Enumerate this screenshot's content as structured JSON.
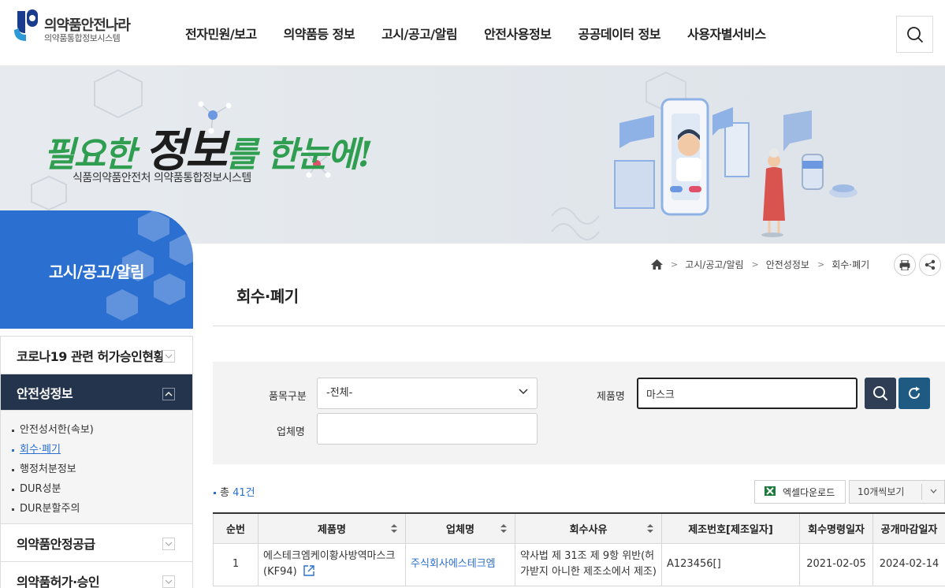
{
  "header": {
    "logo_title": "의약품안전나라",
    "logo_sub": "의약품통합정보시스템",
    "nav": [
      "전자민원/보고",
      "의약품등 정보",
      "고시/공고/알림",
      "안전사용정보",
      "공공데이터 정보",
      "사용자별서비스"
    ],
    "search_icon": "search-icon"
  },
  "banner": {
    "slogan_a": "필요한 ",
    "slogan_hl": "정보",
    "slogan_b": "를 한눈에!",
    "sub": "식품의약품안전처 의약품통합정보시스템"
  },
  "lnb": {
    "section_title": "고시/공고/알림",
    "items": [
      {
        "label": "코로나19 관련 허가승인현황"
      },
      {
        "label": "안전성정보",
        "active": true
      },
      {
        "label": "의약품안정공급"
      },
      {
        "label": "의약품허가·승인"
      }
    ],
    "sub_items": [
      "안전성서한(속보)",
      "회수·폐기",
      "행정처분정보",
      "DUR성분",
      "DUR분할주의"
    ]
  },
  "breadcrumb": [
    "고시/공고/알림",
    "안전성정보",
    "회수·폐기"
  ],
  "page_title": "회수·폐기",
  "search": {
    "category_label": "품목구분",
    "category_value": "-전체-",
    "product_label": "제품명",
    "product_value": "마스크",
    "company_label": "업체명",
    "company_value": ""
  },
  "result": {
    "count_prefix": "총 ",
    "count": "41건",
    "excel_label": "엑셀다운로드",
    "rows_per_page": "10개씩보기"
  },
  "table": {
    "headers": [
      "순번",
      "제품명",
      "업체명",
      "회수사유",
      "제조번호[제조일자]",
      "회수명령일자",
      "공개마감일자"
    ],
    "rows": [
      {
        "no": "1",
        "product": "에스테크엠케이황사방역마스크(KF94)",
        "company": "주식회사에스테크엠",
        "reason": "약사법 제 31조 제 9항 위반(허가받지 아니한 제조소에서 제조)",
        "lot": "A123456[]",
        "order_date": "2021-02-05",
        "close_date": "2024-02-14"
      }
    ]
  },
  "colors": {
    "accent_blue": "#2b6fd0",
    "navy": "#24344d",
    "search_btn": "#2f3e55",
    "reset_btn": "#1e5a82",
    "slogan_green": "#2f9e51"
  }
}
